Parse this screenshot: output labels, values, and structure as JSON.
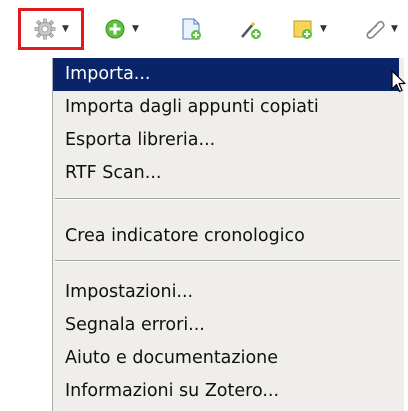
{
  "toolbar": {
    "buttons": [
      {
        "name": "actions",
        "icon": "gear-icon",
        "dropdown": true,
        "highlighted": true
      },
      {
        "name": "new-item",
        "icon": "plus-circle-icon",
        "dropdown": true
      },
      {
        "name": "add-by-identifier",
        "icon": "document-add-icon",
        "dropdown": false
      },
      {
        "name": "new-note",
        "icon": "magic-wand-icon",
        "dropdown": false
      },
      {
        "name": "add-attachment",
        "icon": "note-add-icon",
        "dropdown": true
      },
      {
        "name": "attach",
        "icon": "paperclip-icon",
        "dropdown": true
      }
    ],
    "highlight_color": "#e11b1b"
  },
  "menu": {
    "items": [
      {
        "label": "Importa...",
        "highlighted": true
      },
      {
        "label": "Importa dagli appunti copiati"
      },
      {
        "label": "Esporta libreria..."
      },
      {
        "label": "RTF Scan..."
      },
      {
        "label": "Crea indicatore cronologico"
      },
      {
        "label": "Impostazioni..."
      },
      {
        "label": "Segnala errori..."
      },
      {
        "label": "Aiuto e documentazione"
      },
      {
        "label": "Informazioni su Zotero..."
      }
    ],
    "highlight_color": "#0a246a",
    "background_color": "#efeeeb"
  }
}
